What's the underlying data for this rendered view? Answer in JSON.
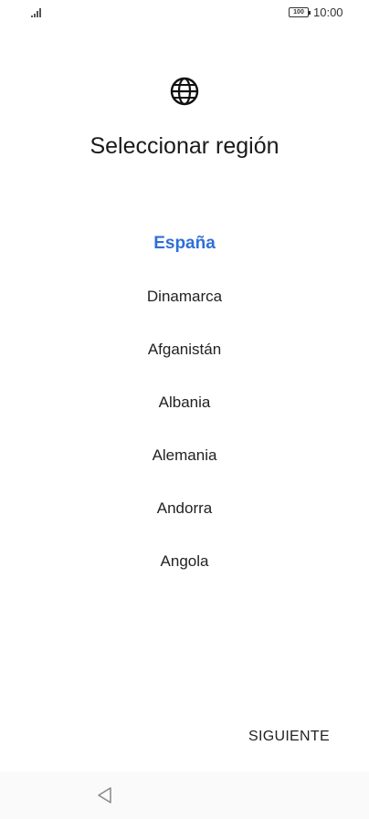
{
  "status_bar": {
    "signal_icon": "signal-icon",
    "battery_level": "100",
    "time": "10:00"
  },
  "header": {
    "icon": "globe-icon",
    "title": "Seleccionar región"
  },
  "regions": {
    "selected": "España",
    "items": [
      "Dinamarca",
      "Afganistán",
      "Albania",
      "Alemania",
      "Andorra",
      "Angola"
    ]
  },
  "footer": {
    "next_label": "SIGUIENTE"
  },
  "nav_bar": {
    "back_icon": "back-triangle-icon"
  },
  "colors": {
    "accent": "#2f6fd6",
    "text": "#1a1a1a"
  }
}
